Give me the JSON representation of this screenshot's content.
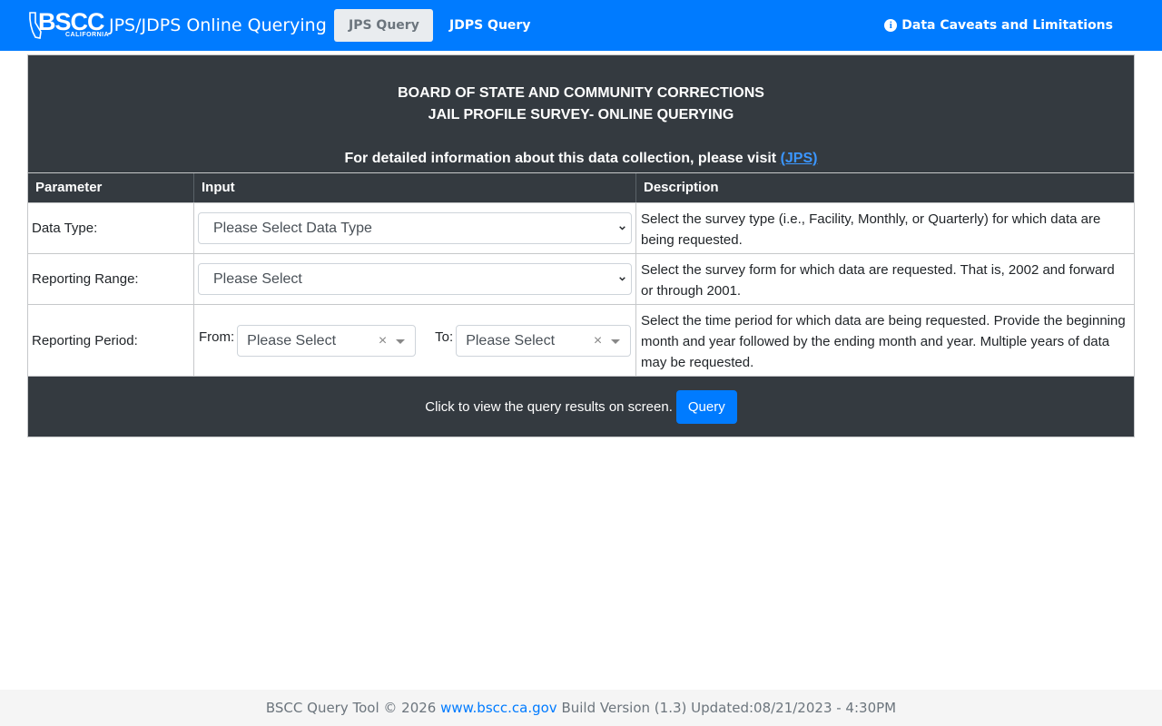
{
  "navbar": {
    "logo_text": "BSCC",
    "logo_subtext": "CALIFORNIA",
    "app_title": "JPS/JDPS Online Querying",
    "tabs": [
      {
        "label": "JPS Query",
        "active": true
      },
      {
        "label": "JDPS Query",
        "active": false
      }
    ],
    "caveats_label": "Data Caveats and Limitations",
    "bg_color": "#007bff"
  },
  "header": {
    "line1": "BOARD OF STATE AND COMMUNITY CORRECTIONS",
    "line2": "JAIL PROFILE SURVEY- ONLINE QUERYING",
    "visit_text": "For detailed information about this data collection, please visit ",
    "visit_link": "(JPS)"
  },
  "table": {
    "columns": [
      "Parameter",
      "Input",
      "Description"
    ],
    "rows": [
      {
        "parameter": "Data Type:",
        "input_value": "Please Select Data Type",
        "description": "Select the survey type (i.e., Facility, Monthly, or Quarterly) for which data are being requested."
      },
      {
        "parameter": "Reporting Range:",
        "input_value": "Please Select",
        "description": "Select the survey form for which data are requested. That is, 2002 and forward or through 2001."
      },
      {
        "parameter": "Reporting Period:",
        "from_label": "From:",
        "from_value": "Please Select",
        "to_label": "To:",
        "to_value": "Please Select",
        "clear_glyph": "×",
        "description": "Select the time period for which data are being requested. Provide the beginning month and year followed by the ending month and year. Multiple years of data may be requested."
      }
    ]
  },
  "query_bar": {
    "prompt": "Click to view the query results on screen.",
    "button_label": "Query"
  },
  "footer": {
    "prefix": "BSCC Query Tool © 2026 ",
    "link": "www.bscc.ca.gov",
    "suffix": " Build Version (1.3) Updated:08/21/2023 - 4:30PM"
  }
}
